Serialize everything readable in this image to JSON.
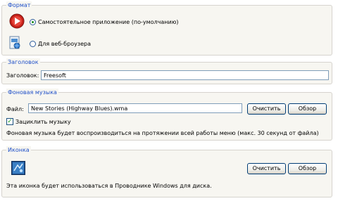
{
  "format": {
    "legend": "Формат",
    "options": [
      {
        "label": "Самостоятельное приложение (по-умолчанию)",
        "selected": true
      },
      {
        "label": "Для веб-броузера",
        "selected": false
      }
    ]
  },
  "title_section": {
    "legend": "Заголовок",
    "field_label": "Заголовок:",
    "value": "Freesoft"
  },
  "music": {
    "legend": "Фоновая музыка",
    "file_label": "Файл:",
    "file_value": "New Stories (Highway Blues).wma",
    "clear_label": "Очистить",
    "browse_label": "Обзор",
    "loop_label": "Зациклить музыку",
    "loop_checked": true,
    "check_mark": "✓",
    "note": "Фоновая музыка будет воспроизводиться на протяжении всей работы меню (макс. 30 секунд от файла)"
  },
  "icon": {
    "legend": "Иконка",
    "clear_label": "Очистить",
    "browse_label": "Обзор",
    "note": "Эта иконка будет использоваться в Проводнике Windows для диска."
  },
  "colors": {
    "legend": "#2050c8",
    "group_bg": "#f7f6f1",
    "app_icon_red": "#c8221a"
  }
}
